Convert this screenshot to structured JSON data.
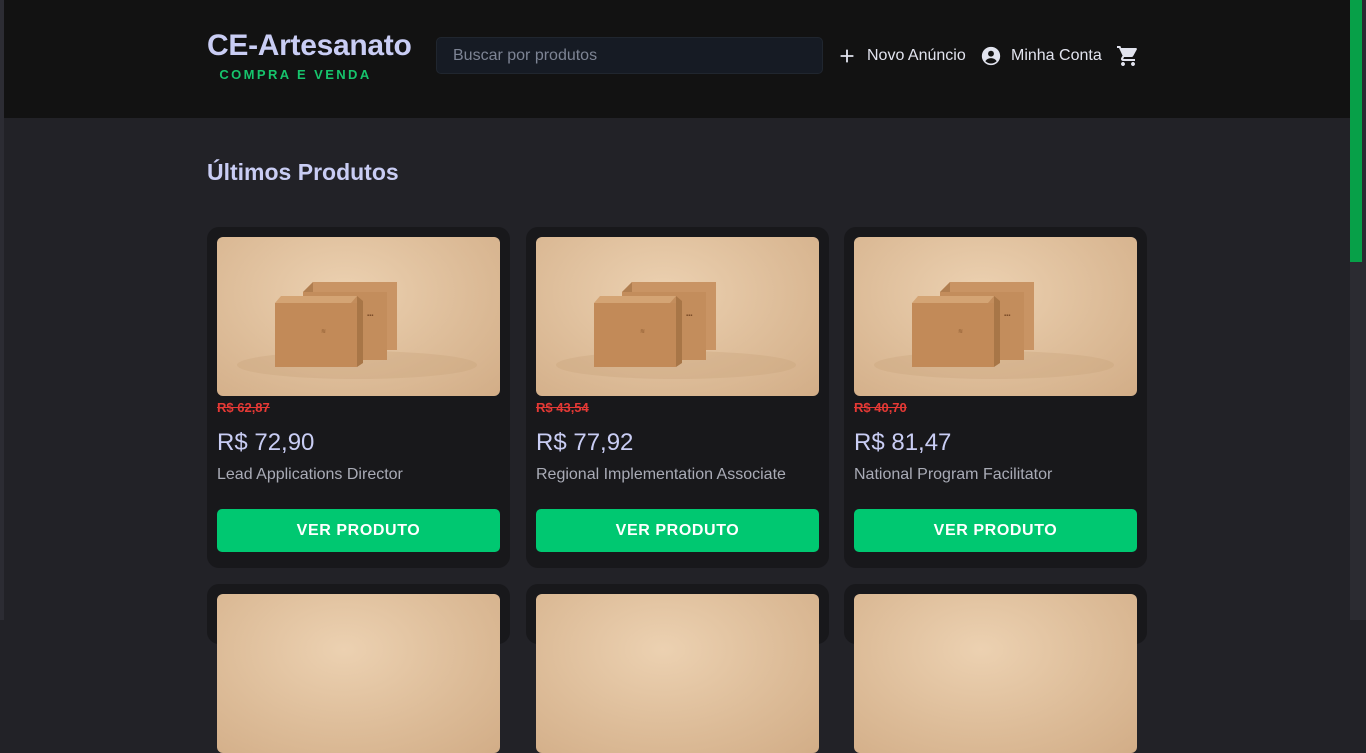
{
  "header": {
    "brand_title": "CE-Artesanato",
    "brand_subtitle": "COMPRA E VENDA",
    "search_placeholder": "Buscar por produtos",
    "new_ad_label": "Novo Anúncio",
    "account_label": "Minha Conta",
    "icons": [
      "plus-icon",
      "account-circle-icon",
      "shopping-cart-icon"
    ]
  },
  "main": {
    "section_title": "Últimos Produtos",
    "products": [
      {
        "old_price": "R$ 62,87",
        "price": "R$ 72,90",
        "name": "Lead Applications Director",
        "button": "VER PRODUTO"
      },
      {
        "old_price": "R$ 43,54",
        "price": "R$ 77,92",
        "name": "Regional Implementation Associate",
        "button": "VER PRODUTO"
      },
      {
        "old_price": "R$ 40,70",
        "price": "R$ 81,47",
        "name": "National Program Facilitator",
        "button": "VER PRODUTO"
      }
    ]
  },
  "colors": {
    "accent": "#00c871",
    "brand_text": "#c9cdf4",
    "old_price": "#e53935",
    "header_bg": "#121212",
    "page_bg": "#222227"
  }
}
